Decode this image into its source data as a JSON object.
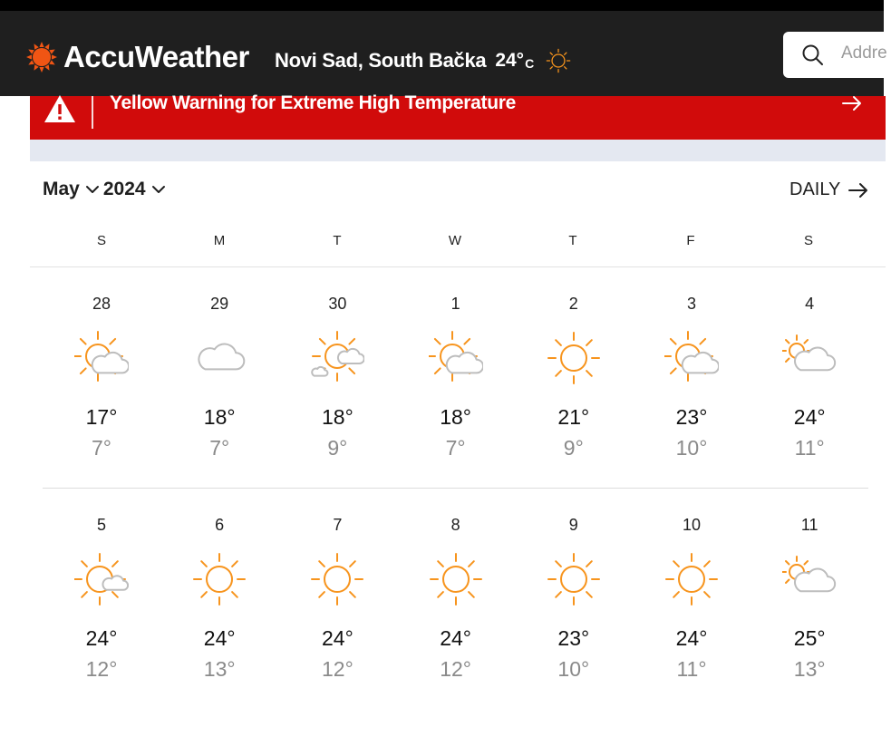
{
  "header": {
    "brand": "AccuWeather",
    "location": "Novi Sad, South Bačka",
    "temp": "24°",
    "unit": "C",
    "search_placeholder": "Address",
    "colors": {
      "bar": "#1f1f1f",
      "brand_orange": "#f05514"
    }
  },
  "alert": {
    "text": "Yellow Warning for Extreme High Temperature",
    "color": "#d10b0b",
    "icon": "warning-triangle-icon"
  },
  "calendar": {
    "month": "May",
    "year": "2024",
    "daily_label": "DAILY",
    "weekdays": [
      "S",
      "M",
      "T",
      "W",
      "T",
      "F",
      "S"
    ],
    "weeks": [
      [
        {
          "day": "28",
          "icon": "partly-sunny-icon",
          "hi": "17°",
          "lo": "7°"
        },
        {
          "day": "29",
          "icon": "cloudy-icon",
          "hi": "18°",
          "lo": "7°"
        },
        {
          "day": "30",
          "icon": "intermittent-clouds-icon",
          "hi": "18°",
          "lo": "9°"
        },
        {
          "day": "1",
          "icon": "partly-sunny-icon",
          "hi": "18°",
          "lo": "7°"
        },
        {
          "day": "2",
          "icon": "sunny-icon",
          "hi": "21°",
          "lo": "9°"
        },
        {
          "day": "3",
          "icon": "partly-sunny-icon",
          "hi": "23°",
          "lo": "10°"
        },
        {
          "day": "4",
          "icon": "mostly-cloudy-icon",
          "hi": "24°",
          "lo": "11°"
        }
      ],
      [
        {
          "day": "5",
          "icon": "mostly-sunny-icon",
          "hi": "24°",
          "lo": "12°"
        },
        {
          "day": "6",
          "icon": "sunny-icon",
          "hi": "24°",
          "lo": "13°"
        },
        {
          "day": "7",
          "icon": "sunny-icon",
          "hi": "24°",
          "lo": "12°"
        },
        {
          "day": "8",
          "icon": "sunny-icon",
          "hi": "24°",
          "lo": "12°"
        },
        {
          "day": "9",
          "icon": "sunny-icon",
          "hi": "23°",
          "lo": "10°"
        },
        {
          "day": "10",
          "icon": "sunny-icon",
          "hi": "24°",
          "lo": "11°"
        },
        {
          "day": "11",
          "icon": "mostly-cloudy-icon",
          "hi": "25°",
          "lo": "13°"
        }
      ]
    ]
  }
}
